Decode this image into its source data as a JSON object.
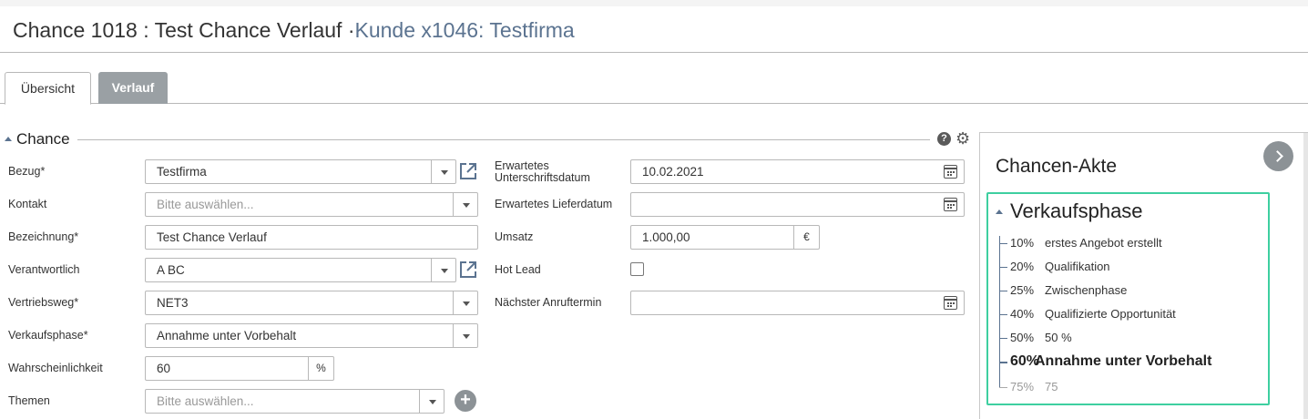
{
  "header": {
    "title": "Chance 1018 : Test Chance Verlauf ·",
    "link": "Kunde x1046: Testfirma"
  },
  "tabs": [
    {
      "label": "Übersicht",
      "active": true
    },
    {
      "label": "Verlauf",
      "active": false
    }
  ],
  "section": {
    "title": "Chance",
    "help_glyph": "?",
    "gear_glyph": "⚙"
  },
  "left_fields": [
    {
      "label": "Bezug*",
      "value": "Testfirma",
      "type": "select",
      "external_link": true
    },
    {
      "label": "Kontakt",
      "placeholder": "Bitte auswählen...",
      "type": "select"
    },
    {
      "label": "Bezeichnung*",
      "value": "Test Chance Verlauf",
      "type": "text"
    },
    {
      "label": "Verantwortlich",
      "value": "A BC",
      "type": "select",
      "external_link": true
    },
    {
      "label": "Vertriebsweg*",
      "value": "NET3",
      "type": "select"
    },
    {
      "label": "Verkaufsphase*",
      "value": "Annahme unter Vorbehalt",
      "type": "select"
    },
    {
      "label": "Wahrscheinlichkeit",
      "value": "60",
      "unit": "%",
      "type": "number"
    },
    {
      "label": "Themen",
      "placeholder": "Bitte auswählen...",
      "type": "select",
      "add_button": "+"
    }
  ],
  "right_fields": [
    {
      "label_line1": "Erwartetes",
      "label_line2": "Unterschriftsdatum",
      "value": "10.02.2021",
      "type": "date"
    },
    {
      "label": "Erwartetes Lieferdatum",
      "value": "",
      "type": "date"
    },
    {
      "label": "Umsatz",
      "value": "1.000,00",
      "unit": "€",
      "type": "currency"
    },
    {
      "label": "Hot Lead",
      "checked": false,
      "type": "checkbox"
    },
    {
      "label": "Nächster Anruftermin",
      "value": "",
      "type": "date"
    }
  ],
  "panel": {
    "title": "Chancen-Akte",
    "phase_title": "Verkaufsphase",
    "phases": [
      {
        "pct": "10%",
        "name": "erstes Angebot erstellt",
        "state": "done"
      },
      {
        "pct": "20%",
        "name": "Qualifikation",
        "state": "done"
      },
      {
        "pct": "25%",
        "name": "Zwischenphase",
        "state": "done"
      },
      {
        "pct": "40%",
        "name": "Qualifizierte Opportunität",
        "state": "done"
      },
      {
        "pct": "50%",
        "name": "50 %",
        "state": "done"
      },
      {
        "pct": "60%",
        "name": "Annahme unter Vorbehalt",
        "state": "current"
      },
      {
        "pct": "75%",
        "name": "75",
        "state": "future"
      }
    ]
  },
  "colors": {
    "link": "#5b7390",
    "accent_border": "#3ecfa0",
    "tab_inactive": "#9aa0a4",
    "button_grey": "#8c9296"
  }
}
